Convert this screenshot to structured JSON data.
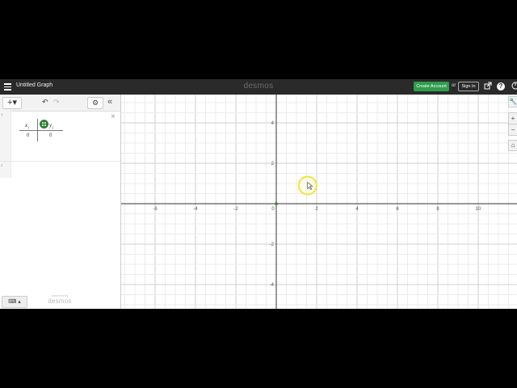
{
  "app": {
    "title": "Untitled Graph",
    "brand": "desmos",
    "create_account_label": "Create Account",
    "or_label": "or",
    "sign_in_label": "Sign In",
    "share_icon": "share-icon",
    "help_icon": "?",
    "accent_green": "#2f9d4b"
  },
  "panel": {
    "add_label": "+▾",
    "undo_icon": "↶",
    "redo_icon": "↷",
    "settings_icon": "⚙",
    "collapse_icon": "«",
    "close_icon": "×",
    "expressions": [
      {
        "number": "1",
        "table": {
          "col1_var": "x",
          "col1_sub": "1",
          "col2_var": "y",
          "col2_sub": "1",
          "rows": [
            [
              "0",
              "0"
            ]
          ]
        }
      },
      {
        "number": "2"
      }
    ],
    "keyboard_label": "⌨ ▴",
    "powered_by": "powered by",
    "powered_brand": "desmos"
  },
  "graph": {
    "x_ticks": [
      "-6",
      "-4",
      "-2",
      "0",
      "2",
      "4",
      "6",
      "8",
      "10"
    ],
    "y_ticks": [
      "4",
      "2",
      "-2",
      "-4"
    ],
    "x_tick_values": [
      -6,
      -4,
      -2,
      0,
      2,
      4,
      6,
      8,
      10
    ],
    "y_tick_values": [
      4,
      2,
      -2,
      -4
    ],
    "points": [
      {
        "x": 0,
        "y": 0
      }
    ],
    "point_color": "#2d7d32",
    "cursor_highlight_color": "#f0e43a",
    "tools": [
      "🔧",
      "+",
      "−",
      "⌂"
    ]
  }
}
